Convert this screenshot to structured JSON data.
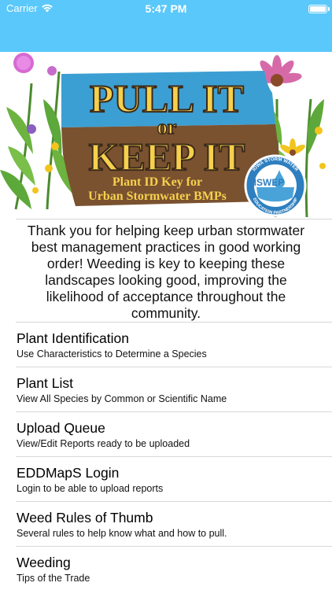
{
  "status_bar": {
    "carrier": "Carrier",
    "time": "5:47 PM",
    "background_color": "#5ac8fa",
    "wifi_icon": "wifi-icon",
    "battery_icon": "battery-icon"
  },
  "banner": {
    "line1": "PULL IT",
    "line2": "or",
    "line3": "KEEP IT",
    "subtitle1": "Plant ID Key for",
    "subtitle2": "Urban Stormwater BMPs",
    "badge_ring_text": "IOWA STORM WATER EDUCATION PARTNERSHIP",
    "badge_text": "ISWEP",
    "colors": {
      "blue": "#3c9fd3",
      "yellow": "#f6d04d",
      "brown": "#7a5230",
      "green": "#5da83a",
      "text_dark": "#3b2a1a"
    }
  },
  "intro_text": "Thank you for helping keep urban stormwater best management practices in good working order! Weeding is key to keeping these landscapes looking good, improving the likelihood of acceptance throughout the community.",
  "menu": [
    {
      "title": "Plant Identification",
      "subtitle": "Use Characteristics to Determine a Species"
    },
    {
      "title": "Plant List",
      "subtitle": "View All Species by Common or Scientific Name"
    },
    {
      "title": "Upload Queue",
      "subtitle": "View/Edit Reports ready to be uploaded"
    },
    {
      "title": "EDDMapS Login",
      "subtitle": "Login to be able to upload reports"
    },
    {
      "title": "Weed Rules of Thumb",
      "subtitle": "Several rules to help know what and how to pull."
    },
    {
      "title": "Weeding",
      "subtitle": "Tips of the Trade"
    }
  ]
}
